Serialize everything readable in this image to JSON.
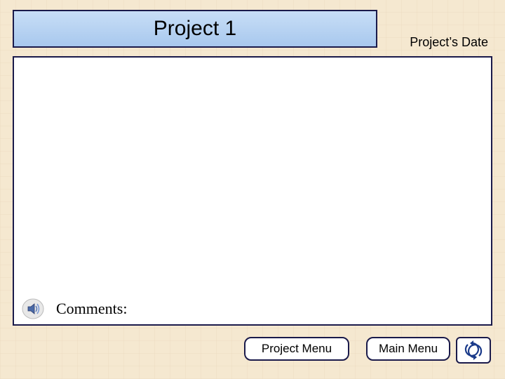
{
  "title": "Project 1",
  "date_label": "Project’s Date",
  "comments_label": "Comments:",
  "buttons": {
    "project_menu": "Project Menu",
    "main_menu": "Main Menu"
  }
}
